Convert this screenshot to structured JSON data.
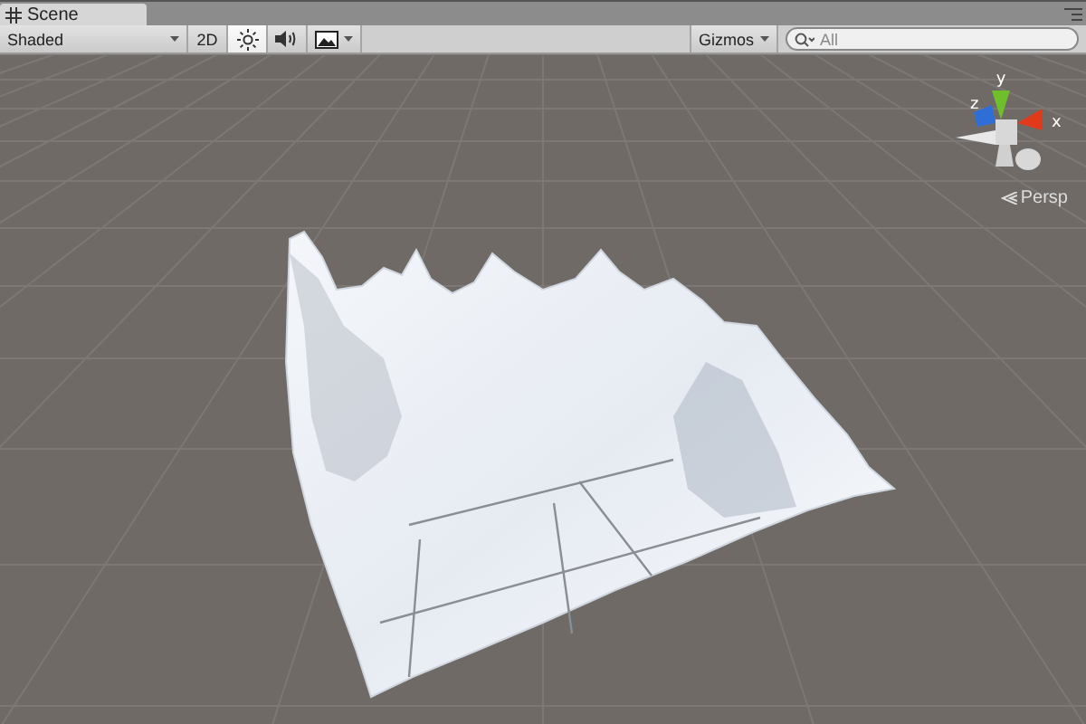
{
  "tab": {
    "title": "Scene"
  },
  "toolbar": {
    "draw_mode": "Shaded",
    "toggles": [
      {
        "kind": "text",
        "label": "2D",
        "selected": false
      },
      {
        "kind": "lighting",
        "selected": true
      },
      {
        "kind": "audio",
        "selected": false
      },
      {
        "kind": "effects",
        "selected": false
      }
    ],
    "gizmos": "Gizmos",
    "search": {
      "placeholder": "All"
    }
  },
  "gizmo": {
    "axes": [
      "y",
      "z",
      "x"
    ],
    "projection": "Persp"
  }
}
